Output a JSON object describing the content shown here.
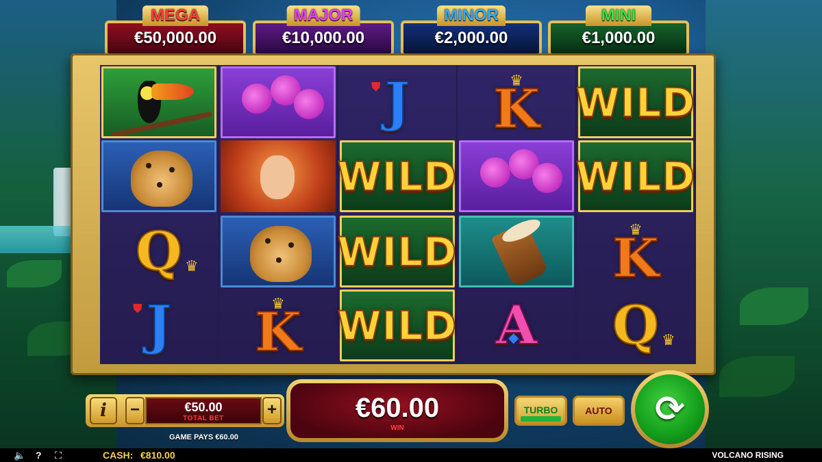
{
  "jackpots": [
    {
      "label": "MEGA",
      "value": "€50,000.00",
      "color": "#ff3b3b"
    },
    {
      "label": "MAJOR",
      "value": "€10,000.00",
      "color": "#e43dff"
    },
    {
      "label": "MINOR",
      "value": "€2,000.00",
      "color": "#36a8ff"
    },
    {
      "label": "MINI",
      "value": "€1,000.00",
      "color": "#33e04a"
    }
  ],
  "reels": [
    [
      "toucan",
      "jaguar",
      "Q",
      "J"
    ],
    [
      "orchid",
      "fire-woman",
      "jaguar",
      "K"
    ],
    [
      "J",
      "WILD",
      "WILD",
      "WILD"
    ],
    [
      "K",
      "orchid",
      "drum",
      "A"
    ],
    [
      "WILD",
      "WILD",
      "K",
      "Q"
    ]
  ],
  "symbols": {
    "wild_text": "WILD",
    "J": "J",
    "K": "K",
    "Q": "Q",
    "A": "A"
  },
  "bet": {
    "value": "€50.00",
    "label": "TOTAL BET",
    "minus": "−",
    "plus": "+"
  },
  "info_label": "i",
  "game_pays": "GAME PAYS €60.00",
  "win": {
    "value": "€60.00",
    "label": "WIN"
  },
  "buttons": {
    "turbo": "TURBO",
    "auto": "AUTO",
    "spin_icon": "spin-icon"
  },
  "status": {
    "cash_label": "CASH:",
    "cash_value": "€810.00",
    "game_title": "VOLCANO RISING"
  },
  "icons": {
    "sound": "speaker-icon",
    "help": "question-icon",
    "fullscreen": "fullscreen-icon"
  }
}
